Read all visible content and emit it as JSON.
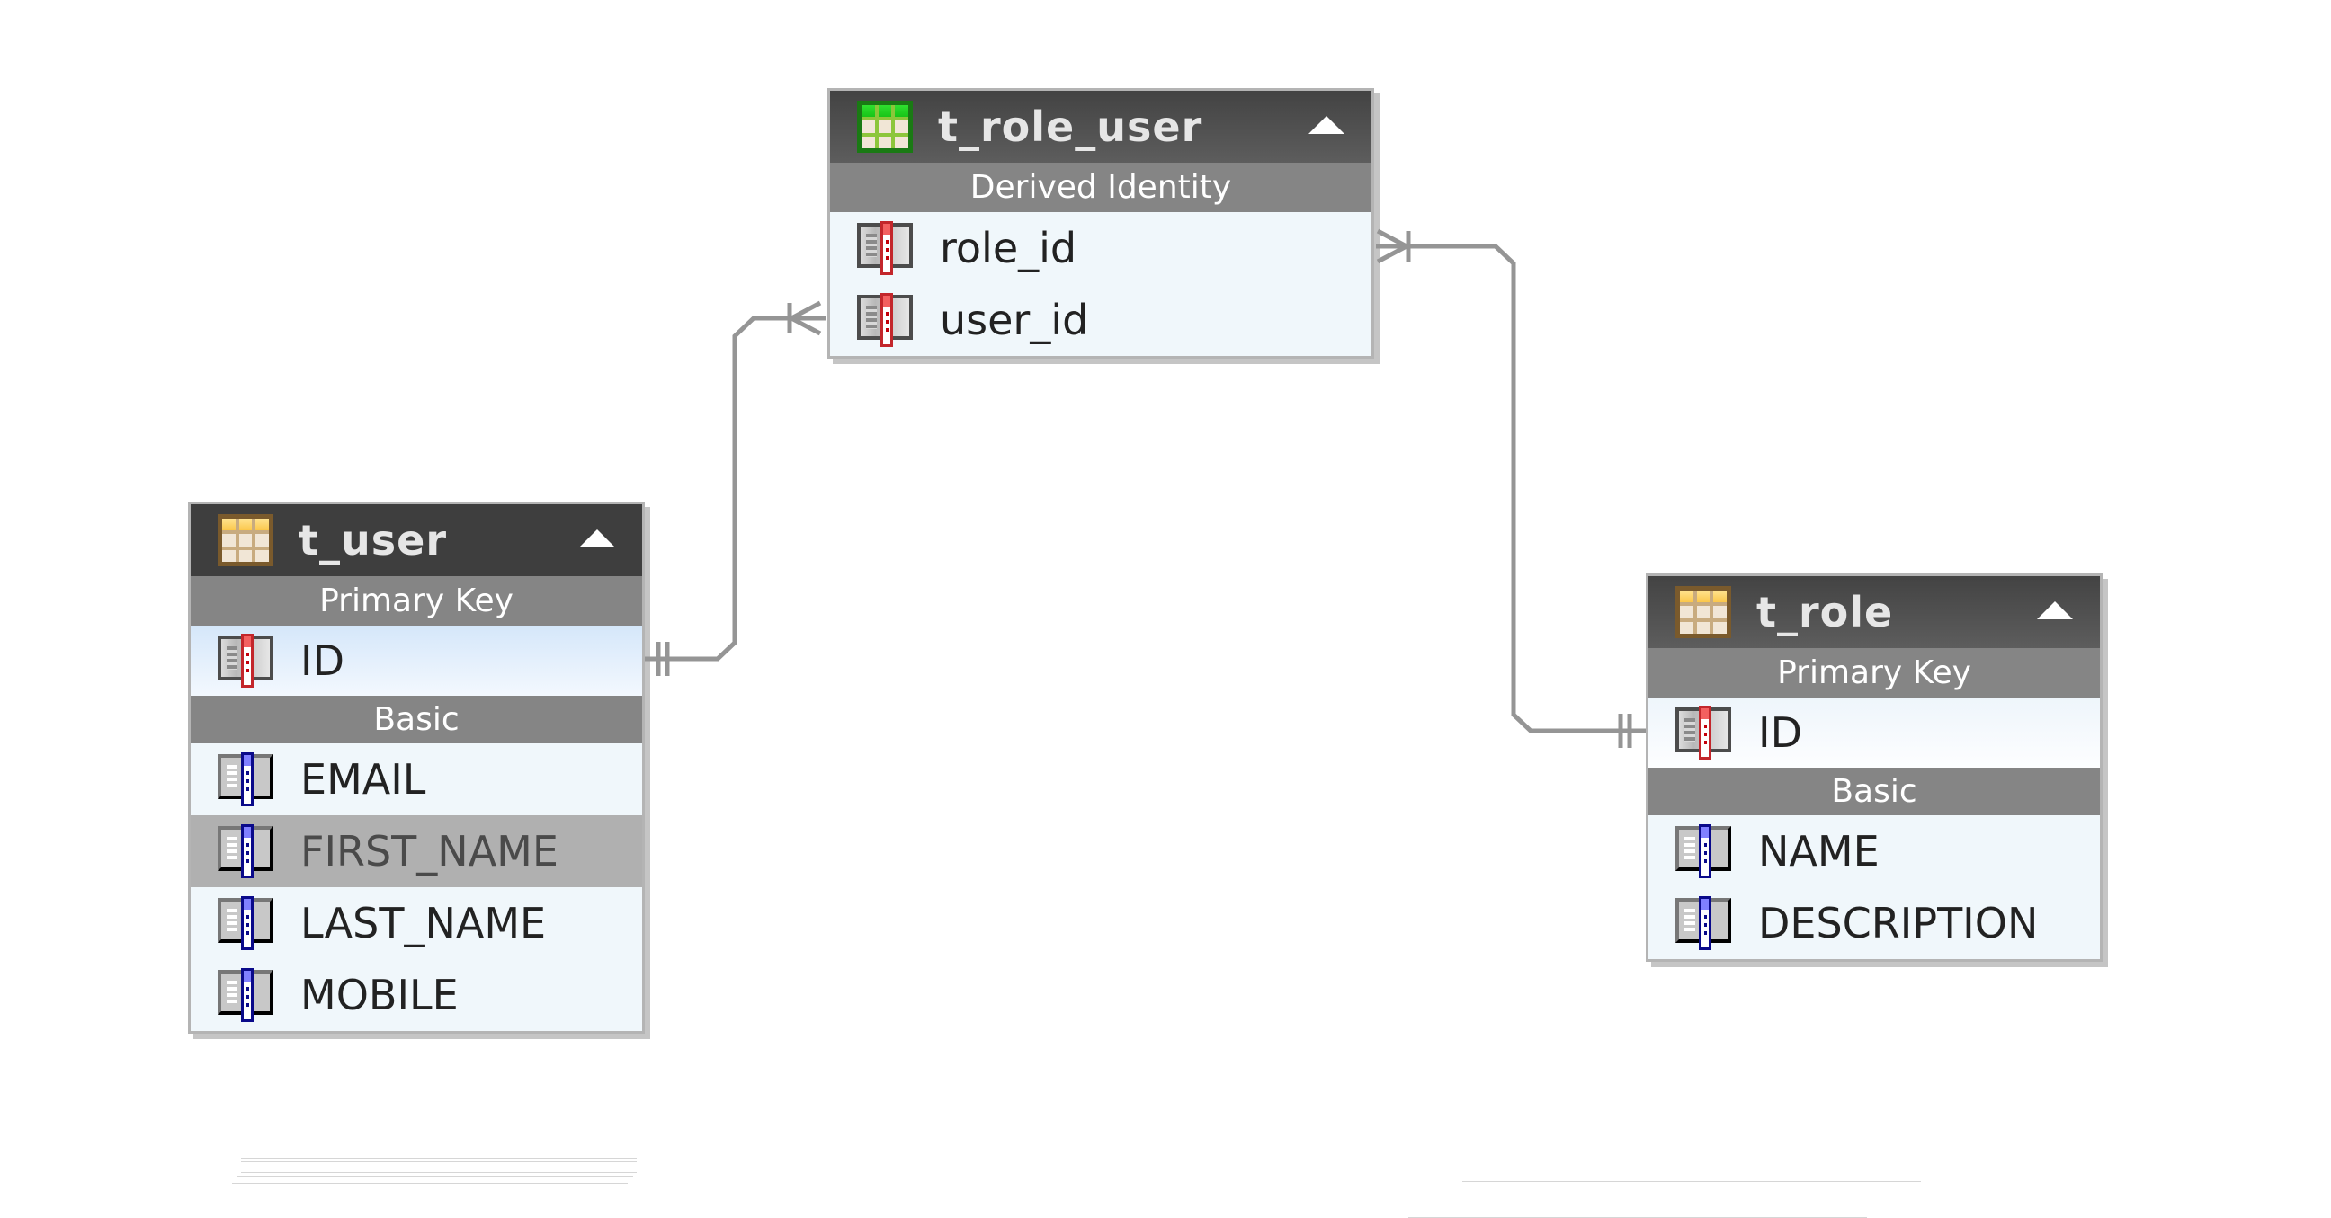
{
  "diagram": {
    "type": "entity-relationship",
    "entities": [
      {
        "id": "t_role_user",
        "name": "t_role_user",
        "icon": "join-table-icon",
        "collapsed": false,
        "sections": [
          {
            "label": "Derived Identity",
            "columns": [
              {
                "name": "role_id",
                "key": "pk"
              },
              {
                "name": "user_id",
                "key": "pk"
              }
            ]
          }
        ]
      },
      {
        "id": "t_user",
        "name": "t_user",
        "icon": "table-icon",
        "collapsed": false,
        "sections": [
          {
            "label": "Primary Key",
            "columns": [
              {
                "name": "ID",
                "key": "pk",
                "selected": true
              }
            ]
          },
          {
            "label": "Basic",
            "columns": [
              {
                "name": "EMAIL",
                "key": "basic"
              },
              {
                "name": "FIRST_NAME",
                "key": "basic",
                "highlighted": true
              },
              {
                "name": "LAST_NAME",
                "key": "basic"
              },
              {
                "name": "MOBILE",
                "key": "basic"
              }
            ]
          }
        ]
      },
      {
        "id": "t_role",
        "name": "t_role",
        "icon": "table-icon",
        "collapsed": false,
        "sections": [
          {
            "label": "Primary Key",
            "columns": [
              {
                "name": "ID",
                "key": "pk"
              }
            ]
          },
          {
            "label": "Basic",
            "columns": [
              {
                "name": "NAME",
                "key": "basic"
              },
              {
                "name": "DESCRIPTION",
                "key": "basic"
              }
            ]
          }
        ]
      }
    ],
    "relationships": [
      {
        "from": "t_user.ID",
        "from_cardinality": "exactly-one",
        "to": "t_role_user.user_id",
        "to_cardinality": "one-or-many"
      },
      {
        "from": "t_role.ID",
        "from_cardinality": "exactly-one",
        "to": "t_role_user.role_id",
        "to_cardinality": "one-or-many"
      }
    ],
    "colors": {
      "header": "#3e3e3e",
      "section": "#858585",
      "row": "#f0f7fb",
      "row_highlight": "#b0b0b0",
      "connector": "#959595"
    }
  }
}
